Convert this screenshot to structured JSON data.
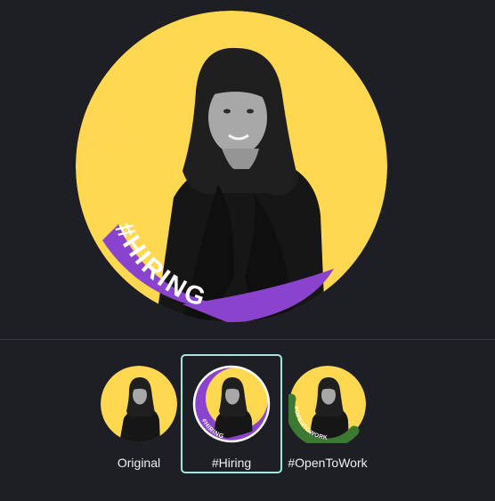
{
  "preview": {
    "frame_text": "#HIRING",
    "colors": {
      "yellow": "#ffd852",
      "purple": "#8a43cc",
      "background": "#1d1f24"
    }
  },
  "frames": {
    "selected": "#Hiring",
    "options": [
      {
        "label": "Original"
      },
      {
        "label": "#Hiring",
        "frame_text": "#HIRING",
        "accent": "#8a43cc"
      },
      {
        "label": "#OpenToWork",
        "frame_text": "#OPENTOWORK",
        "accent": "#3c7a33"
      }
    ]
  }
}
